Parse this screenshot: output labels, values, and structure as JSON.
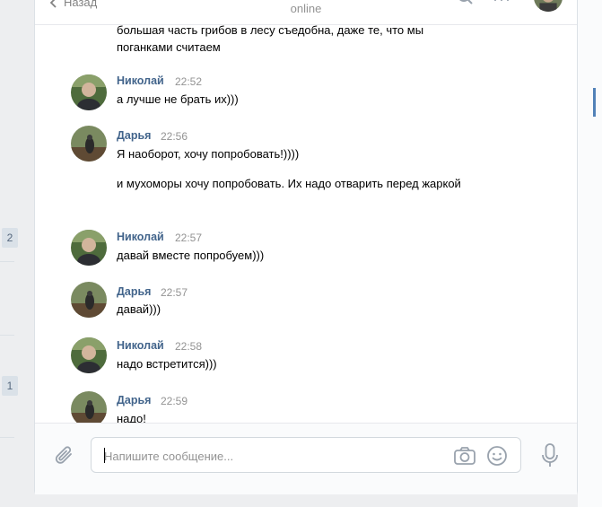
{
  "header": {
    "back_label": "Назад",
    "status": "online"
  },
  "left_badges": [
    "2",
    "1"
  ],
  "messages": [
    {
      "type": "continuation",
      "text": "большая часть грибов в лесу съедобна, даже те, что мы поганками считаем"
    },
    {
      "type": "head",
      "author": "Николай",
      "time": "22:52",
      "avatar": "nikolay",
      "text": "а лучше не брать их)))"
    },
    {
      "type": "head",
      "author": "Дарья",
      "time": "22:56",
      "avatar": "darya",
      "text": "Я наоборот, хочу попробовать!))))"
    },
    {
      "type": "continuation",
      "text": "и мухоморы хочу попробовать. Их надо отварить перед жаркой"
    },
    {
      "type": "head",
      "author": "Николай",
      "time": "22:57",
      "avatar": "nikolay",
      "text": "давай вместе попробуем)))"
    },
    {
      "type": "head",
      "author": "Дарья",
      "time": "22:57",
      "avatar": "darya",
      "text": "давай)))"
    },
    {
      "type": "head",
      "author": "Николай",
      "time": "22:58",
      "avatar": "nikolay",
      "text": "надо встретится)))"
    },
    {
      "type": "head",
      "author": "Дарья",
      "time": "22:59",
      "avatar": "darya",
      "text": "надо!"
    }
  ],
  "composer": {
    "placeholder": "Напишите сообщение...",
    "value": ""
  },
  "icons": {
    "back": "chevron-left-icon",
    "search": "search-icon",
    "more": "more-icon",
    "attach": "paperclip-icon",
    "camera": "camera-icon",
    "emoji": "smile-icon",
    "voice": "microphone-icon"
  },
  "colors": {
    "author": "#42648b",
    "time": "#939393",
    "background": "#edeef0",
    "icon": "#99a2ad",
    "accent": "#5181b8"
  }
}
